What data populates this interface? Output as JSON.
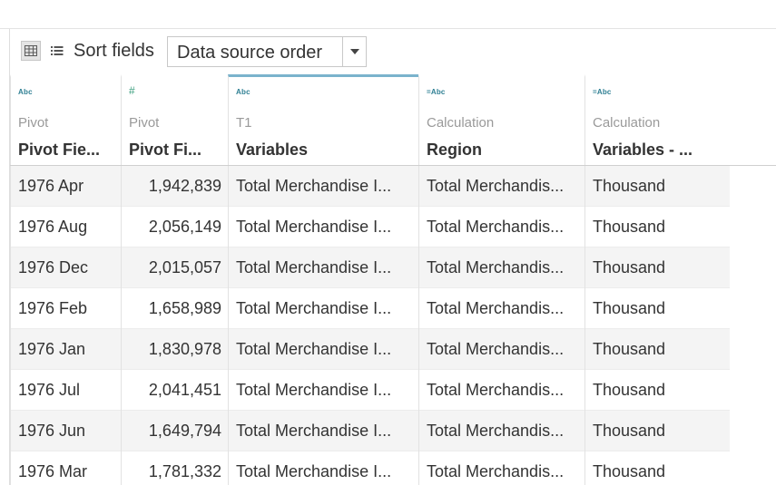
{
  "toolbar": {
    "grid_view_icon": "grid-view-icon",
    "list_view_icon": "list-view-icon",
    "sort_label": "Sort fields",
    "sort_value": "Data source order",
    "dropdown_icon": "caret-down-icon"
  },
  "columns": [
    {
      "type": "Abc",
      "source": "Pivot",
      "name": "Pivot Fie..."
    },
    {
      "type": "#",
      "source": "Pivot",
      "name": "Pivot Fi..."
    },
    {
      "type": "Abc",
      "source": "T1",
      "name": "Variables"
    },
    {
      "type": "=Abc",
      "source": "Calculation",
      "name": "Region"
    },
    {
      "type": "=Abc",
      "source": "Calculation",
      "name": "Variables - ..."
    }
  ],
  "rows": [
    [
      "1976 Apr",
      "1,942,839",
      "Total Merchandise I...",
      "Total Merchandis...",
      "Thousand"
    ],
    [
      "1976 Aug",
      "2,056,149",
      "Total Merchandise I...",
      "Total Merchandis...",
      "Thousand"
    ],
    [
      "1976 Dec",
      "2,015,057",
      "Total Merchandise I...",
      "Total Merchandis...",
      "Thousand"
    ],
    [
      "1976 Feb",
      "1,658,989",
      "Total Merchandise I...",
      "Total Merchandis...",
      "Thousand"
    ],
    [
      "1976 Jan",
      "1,830,978",
      "Total Merchandise I...",
      "Total Merchandis...",
      "Thousand"
    ],
    [
      "1976 Jul",
      "2,041,451",
      "Total Merchandise I...",
      "Total Merchandis...",
      "Thousand"
    ],
    [
      "1976 Jun",
      "1,649,794",
      "Total Merchandise I...",
      "Total Merchandis...",
      "Thousand"
    ],
    [
      "1976 Mar",
      "1,781,332",
      "Total Merchandise I...",
      "Total Merchandis...",
      "Thousand"
    ]
  ],
  "colors": {
    "selected_column_accent": "#7ab3cc",
    "type_icon_text": "#2e7f93",
    "type_icon_number": "#3b9e7e",
    "row_stripe": "#f4f4f4"
  }
}
